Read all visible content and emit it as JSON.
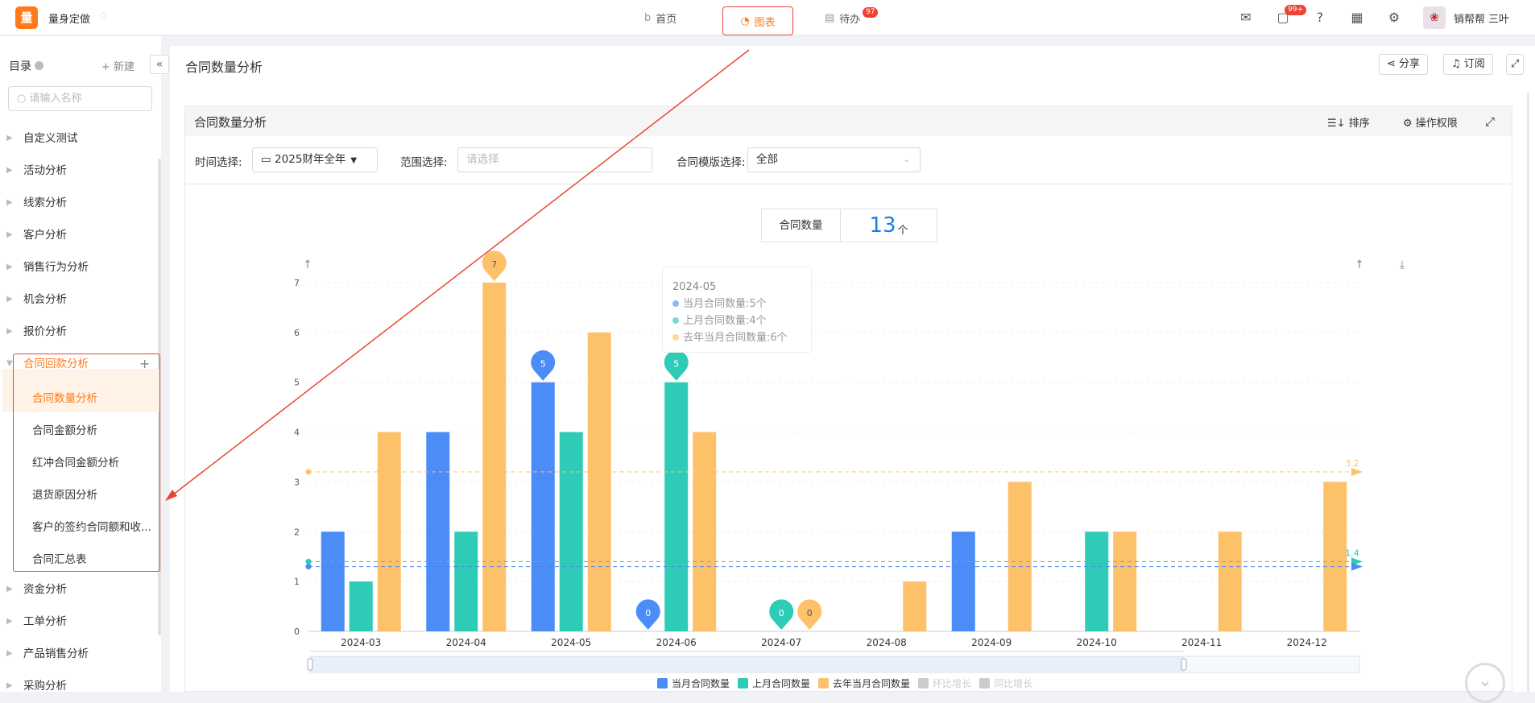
{
  "app": {
    "logo_char": "量",
    "name": "量身定做"
  },
  "topnav": {
    "home": "首页",
    "chart": "图表",
    "todo": "待办",
    "todo_badge": "97"
  },
  "topright": {
    "msg_badge": "99+",
    "user": "销帮帮 三叶"
  },
  "sidebar": {
    "title": "目录",
    "new_label": "新建",
    "search_placeholder": "请输入名称",
    "items": [
      "自定义测试",
      "活动分析",
      "线索分析",
      "客户分析",
      "销售行为分析",
      "机会分析",
      "报价分析"
    ],
    "expanded": {
      "label": "合同回款分析",
      "children": [
        "合同数量分析",
        "合同金额分析",
        "红冲合同金额分析",
        "退货原因分析",
        "客户的签约合同额和收...",
        "合同汇总表"
      ]
    },
    "items_after": [
      "资金分析",
      "工单分析",
      "产品销售分析",
      "采购分析"
    ]
  },
  "page": {
    "title": "合同数量分析",
    "share": "分享",
    "subscribe": "订阅"
  },
  "panel": {
    "title": "合同数量分析",
    "sort": "排序",
    "permission": "操作权限"
  },
  "filters": {
    "time_label": "时间选择:",
    "time_value": "2025财年全年",
    "range_label": "范围选择:",
    "range_placeholder": "请选择",
    "template_label": "合同模版选择:",
    "template_value": "全部"
  },
  "kpi": {
    "label": "合同数量",
    "value": "13",
    "unit": "个"
  },
  "tooltip": {
    "date": "2024-05",
    "rows": [
      "当月合同数量:5个",
      "上月合同数量:4个",
      "去年当月合同数量:6个"
    ]
  },
  "colors": {
    "blue": "#4b8cf7",
    "teal": "#2ecbb7",
    "orange": "#fdc16a",
    "accent": "#ff7a1a",
    "annotation": "#e64735"
  },
  "chart_data": {
    "type": "bar",
    "categories": [
      "2024-03",
      "2024-04",
      "2024-05",
      "2024-06",
      "2024-07",
      "2024-08",
      "2024-09",
      "2024-10",
      "2024-11",
      "2024-12"
    ],
    "series": [
      {
        "name": "当月合同数量",
        "color": "#4b8cf7",
        "values": [
          2,
          4,
          5,
          0,
          0,
          0,
          2,
          0,
          0,
          0
        ]
      },
      {
        "name": "上月合同数量",
        "color": "#2ecbb7",
        "values": [
          1,
          2,
          4,
          5,
          0,
          0,
          0,
          2,
          0,
          0
        ]
      },
      {
        "name": "去年当月合同数量",
        "color": "#fdc16a",
        "values": [
          4,
          7,
          6,
          4,
          0,
          1,
          3,
          2,
          2,
          3
        ]
      }
    ],
    "hidden_series": [
      "环比增长",
      "同比增长"
    ],
    "markpoints": [
      {
        "series": 2,
        "index": 1,
        "label": "7"
      },
      {
        "series": 0,
        "index": 2,
        "label": "5"
      },
      {
        "series": 1,
        "index": 3,
        "label": "5"
      },
      {
        "series": 0,
        "index": 3,
        "label": "0"
      },
      {
        "series": 1,
        "index": 4,
        "label": "0"
      },
      {
        "series": 2,
        "index": 4,
        "label": "0"
      }
    ],
    "average_lines": [
      {
        "series": 2,
        "value": 3.2,
        "label": "3.2"
      },
      {
        "series": 1,
        "value": 1.4,
        "label": "1.4"
      },
      {
        "series": 0,
        "value": 1.3,
        "label": ""
      }
    ],
    "yticks": [
      0,
      1,
      2,
      3,
      4,
      5,
      6,
      7
    ],
    "ylim": [
      0,
      7
    ],
    "grid": true,
    "legend": "bottom"
  }
}
